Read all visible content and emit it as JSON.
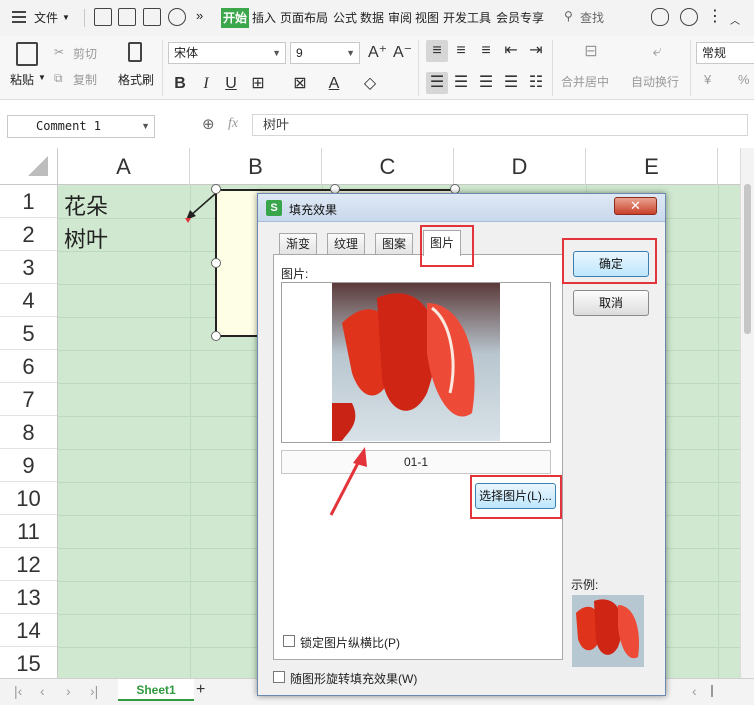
{
  "menubar": {
    "file": "文件",
    "tabs": [
      "开始",
      "插入",
      "页面布局",
      "公式",
      "数据",
      "审阅",
      "视图",
      "开发工具",
      "会员专享"
    ],
    "search": "查找",
    "more": "»"
  },
  "ribbon": {
    "paste": "粘贴",
    "cut": "剪切",
    "copy": "复制",
    "format_painter": "格式刷",
    "font_name": "宋体",
    "font_size": "9",
    "merge_center": "合并居中",
    "wrap_text": "自动换行",
    "number_format": "常规",
    "currency_symbol": "¥",
    "percent_symbol": "%"
  },
  "formula_bar": {
    "name_box": "Comment 1",
    "fx": "fx",
    "content": "树叶"
  },
  "grid": {
    "columns": [
      "A",
      "B",
      "C",
      "D",
      "E"
    ],
    "rows": [
      "1",
      "2",
      "3",
      "4",
      "5",
      "6",
      "7",
      "8",
      "9",
      "10",
      "11",
      "12",
      "13",
      "14",
      "15"
    ],
    "cells": {
      "A1": "花朵",
      "A2": "树叶"
    }
  },
  "sheets": {
    "active": "Sheet1",
    "add": "+"
  },
  "dialog": {
    "title": "填充效果",
    "logo": "S",
    "close": "✕",
    "tabs": [
      "渐变",
      "纹理",
      "图案",
      "图片"
    ],
    "active_tab": "图片",
    "picture_label": "图片:",
    "picture_name": "01-1",
    "select_picture_button": "选择图片(L)...",
    "lock_ratio_label": "锁定图片纵横比(P)",
    "rotate_with_shape_label": "随图形旋转填充效果(W)",
    "ok_button": "确定",
    "cancel_button": "取消",
    "sample_label": "示例:"
  },
  "colors": {
    "accent_green": "#3ca64b",
    "grid_fill": "#cfe8cf",
    "highlight_red": "#e2343a"
  }
}
